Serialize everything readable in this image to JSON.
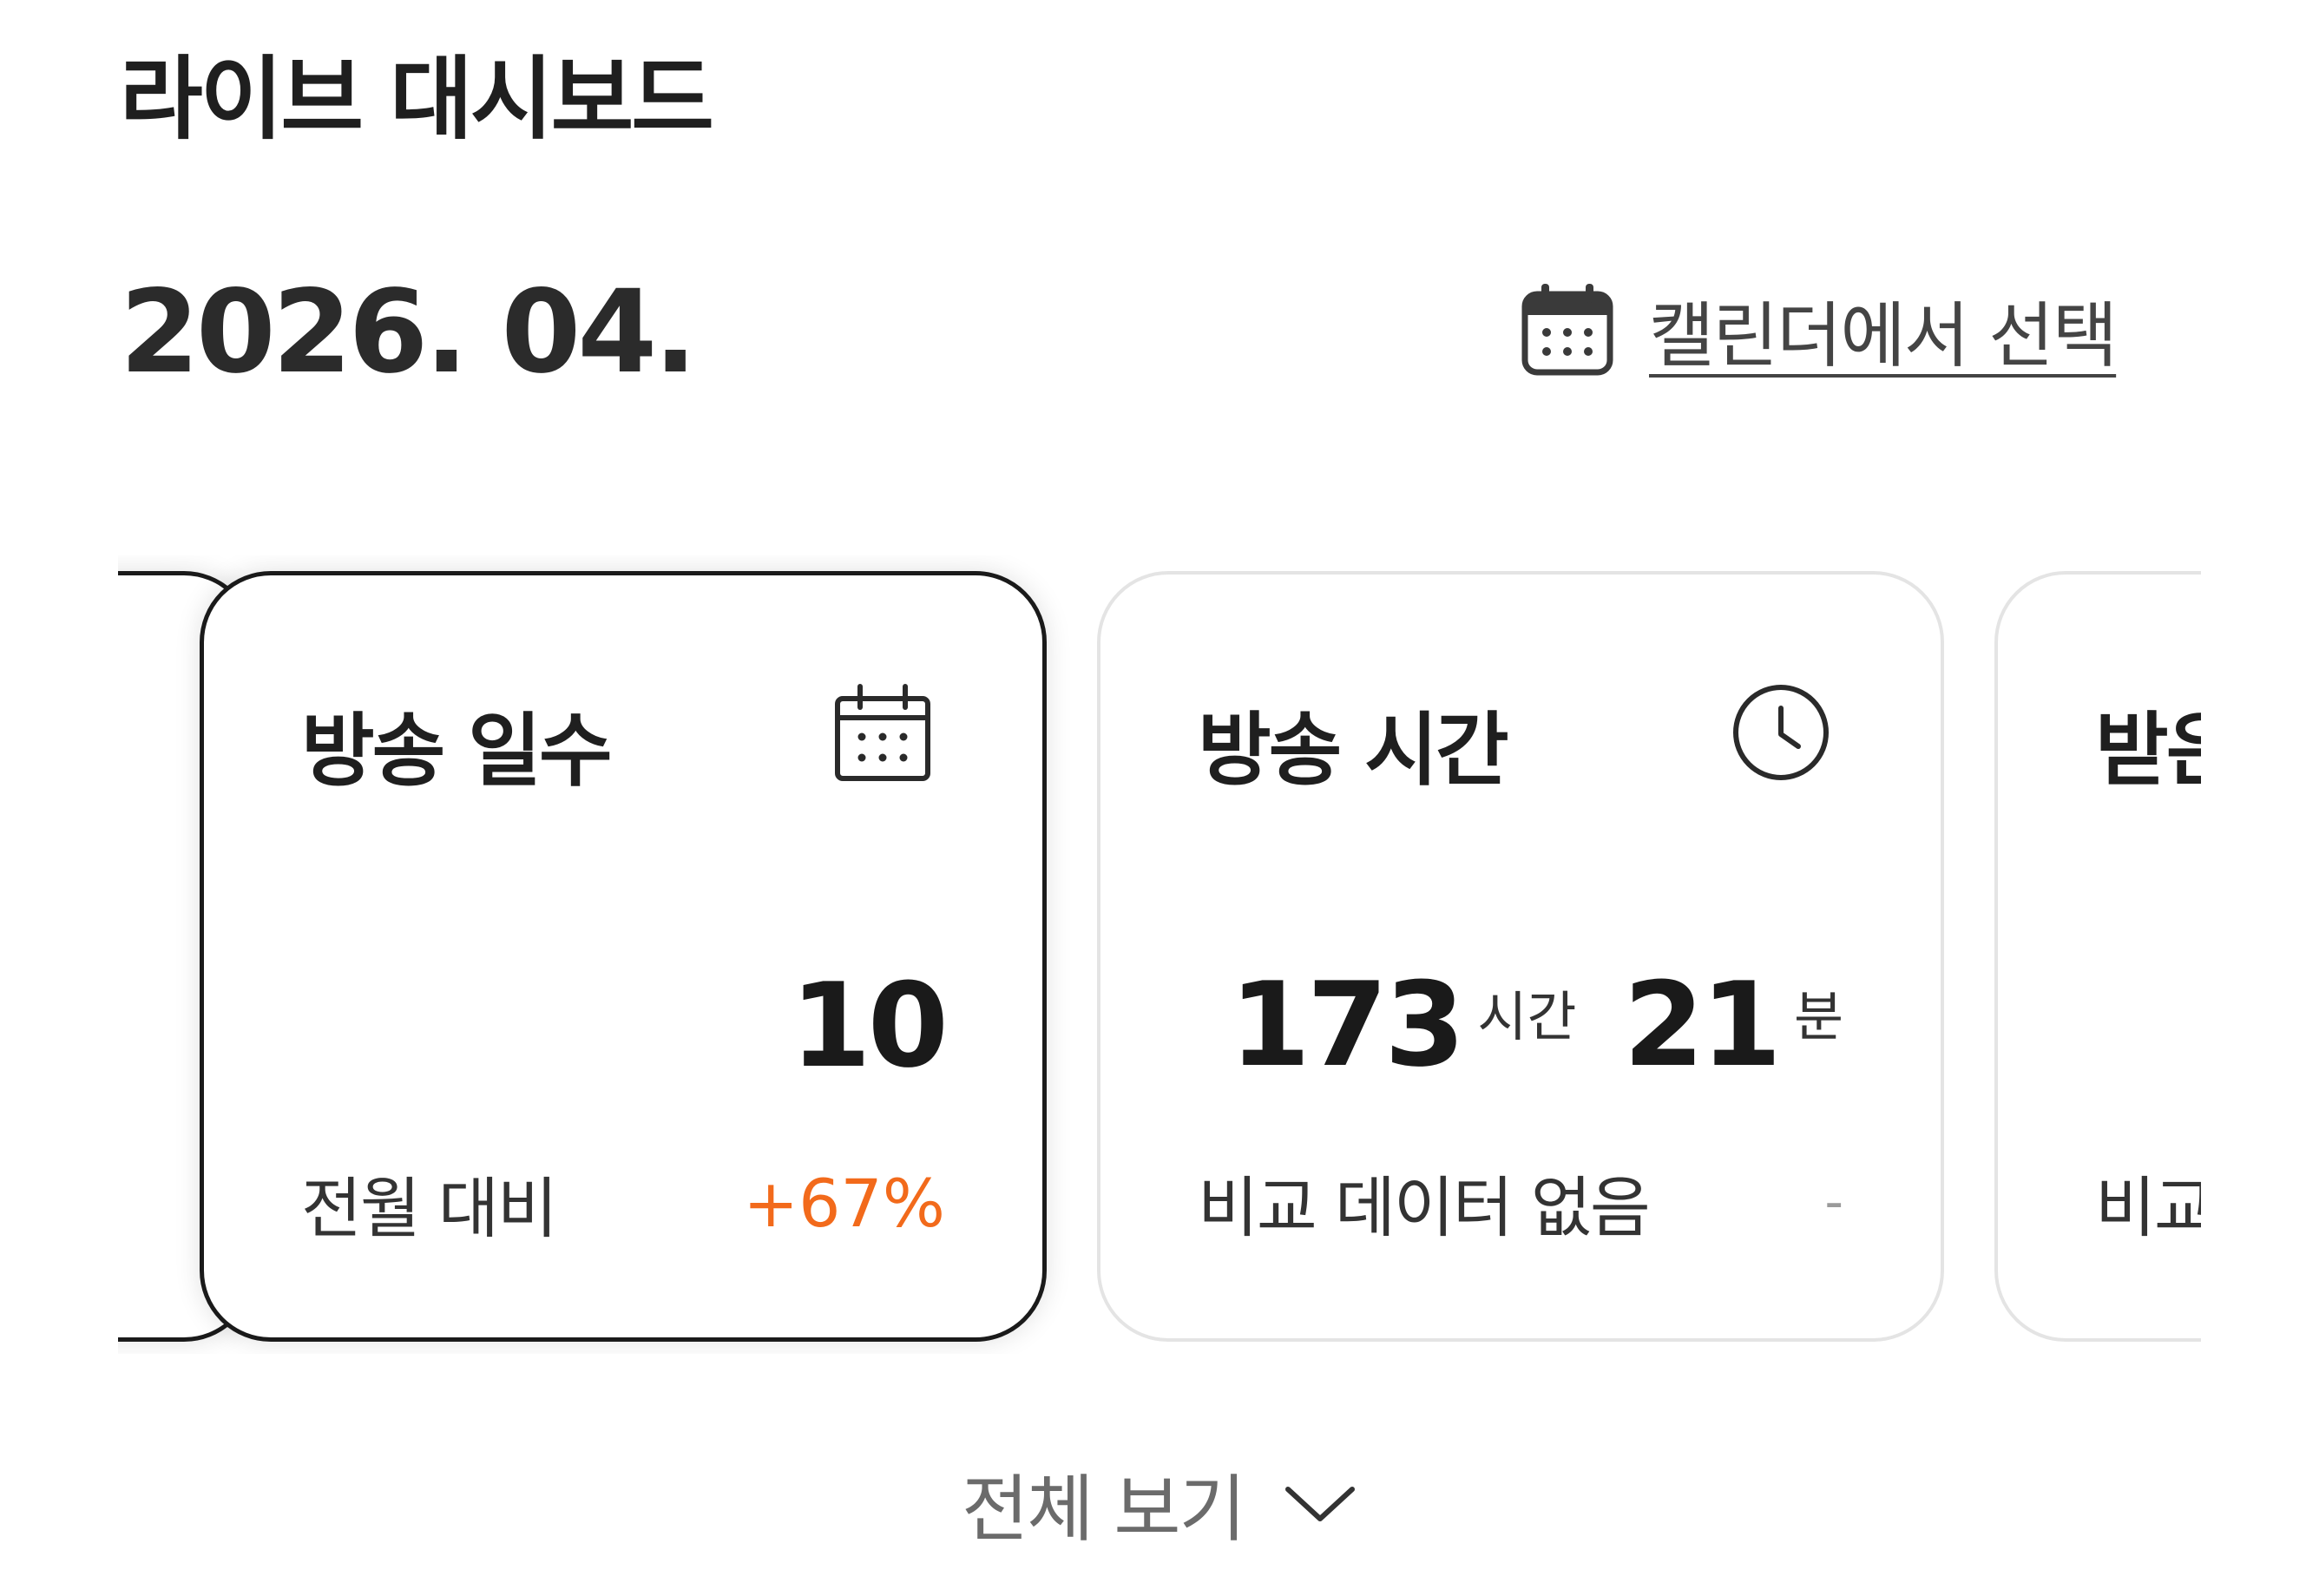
{
  "header": {
    "title": "라이브 대시보드",
    "month": "2026. 04.",
    "calendar_link_label": "캘린더에서 선택"
  },
  "cards": [
    {
      "title": "",
      "icon": "partial-card",
      "compare_label": "",
      "compare_value": ""
    },
    {
      "title": "방송 일수",
      "icon": "calendar-icon",
      "value": "10",
      "compare_label": "전월 대비",
      "compare_value": "+67%",
      "selected": true
    },
    {
      "title": "방송 시간",
      "icon": "clock-icon",
      "hours": "173",
      "hours_unit": "시간",
      "minutes": "21",
      "minutes_unit": "분",
      "compare_label": "비교 데이터 없음",
      "compare_value": "-",
      "selected": false
    },
    {
      "title": "받은",
      "compare_label": "비교",
      "selected": false
    }
  ],
  "footer": {
    "view_all_label": "전체 보기"
  },
  "colors": {
    "accent_positive": "#f26a1b",
    "active_border": "#1a1a1a",
    "inactive_border": "#e4e4e4"
  }
}
